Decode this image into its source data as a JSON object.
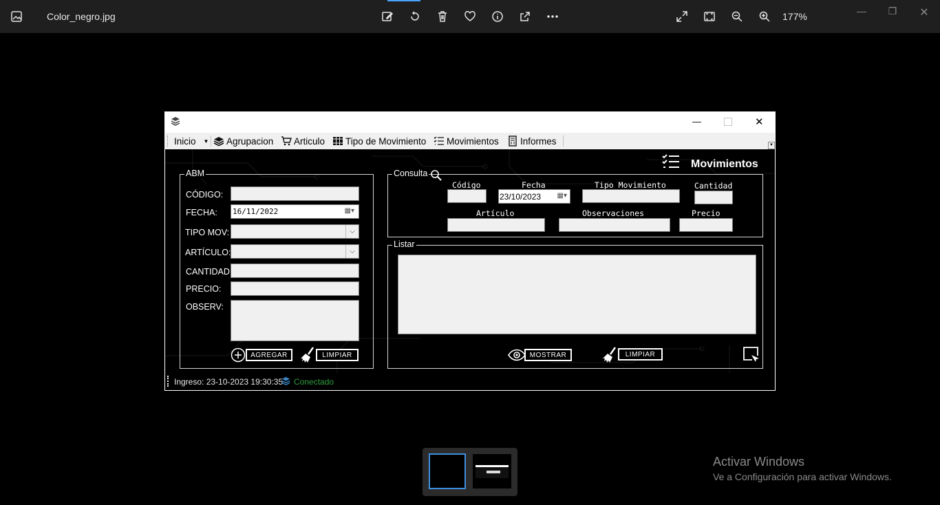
{
  "viewer": {
    "file_name": "Color_negro.jpg",
    "zoom": "177%",
    "toolbar_icons": [
      "edit-icon",
      "rotate-icon",
      "delete-icon",
      "favorite-icon",
      "info-icon",
      "share-icon",
      "more-icon"
    ],
    "right_icons": [
      "fullscreen-icon",
      "fit-icon",
      "zoom-out-icon",
      "zoom-in-icon"
    ]
  },
  "app": {
    "menu": {
      "inicio": "Inicio",
      "agrupacion": "Agrupacion",
      "articulo": "Articulo",
      "tipo_movimiento": "Tipo de Movimiento",
      "movimientos": "Movimientos",
      "informes": "Informes"
    },
    "page_title": "Movimientos",
    "abm": {
      "title": "ABM",
      "codigo_label": "CÓDIGO:",
      "codigo_value": "",
      "fecha_label": "FECHA:",
      "fecha_value": "16/11/2022",
      "tipo_mov_label": "TIPO MOV:",
      "tipo_mov_value": "",
      "articulo_label": "ARTÍCULO:",
      "articulo_value": "",
      "cantidad_label": "CANTIDAD:",
      "cantidad_value": "",
      "precio_label": "PRECIO:",
      "precio_value": "",
      "observ_label": "OBSERV:",
      "observ_value": "",
      "agregar_button": "AGREGAR",
      "limpiar_button": "LIMPIAR"
    },
    "consulta": {
      "title": "Consulta",
      "codigo_header": "Código",
      "codigo_value": "",
      "fecha_header": "Fecha",
      "fecha_value": "23/10/2023",
      "tipo_header": "Tipo Movimiento",
      "tipo_value": "",
      "cantidad_header": "Cantidad",
      "cantidad_value": "",
      "articulo_header": "Artículo",
      "articulo_value": "",
      "observaciones_header": "Observaciones",
      "observaciones_value": "",
      "precio_header": "Precio",
      "precio_value": ""
    },
    "listar": {
      "title": "Listar",
      "mostrar_button": "MOSTRAR",
      "limpiar_button": "LIMPIAR"
    },
    "status": {
      "ingreso": "Ingreso: 23-10-2023 19:30:35",
      "conexion": "Conectado",
      "conexion_color": "#2e9e3e"
    }
  },
  "windows_activation": {
    "line1": "Activar Windows",
    "line2": "Ve a Configuración para activar Windows."
  }
}
